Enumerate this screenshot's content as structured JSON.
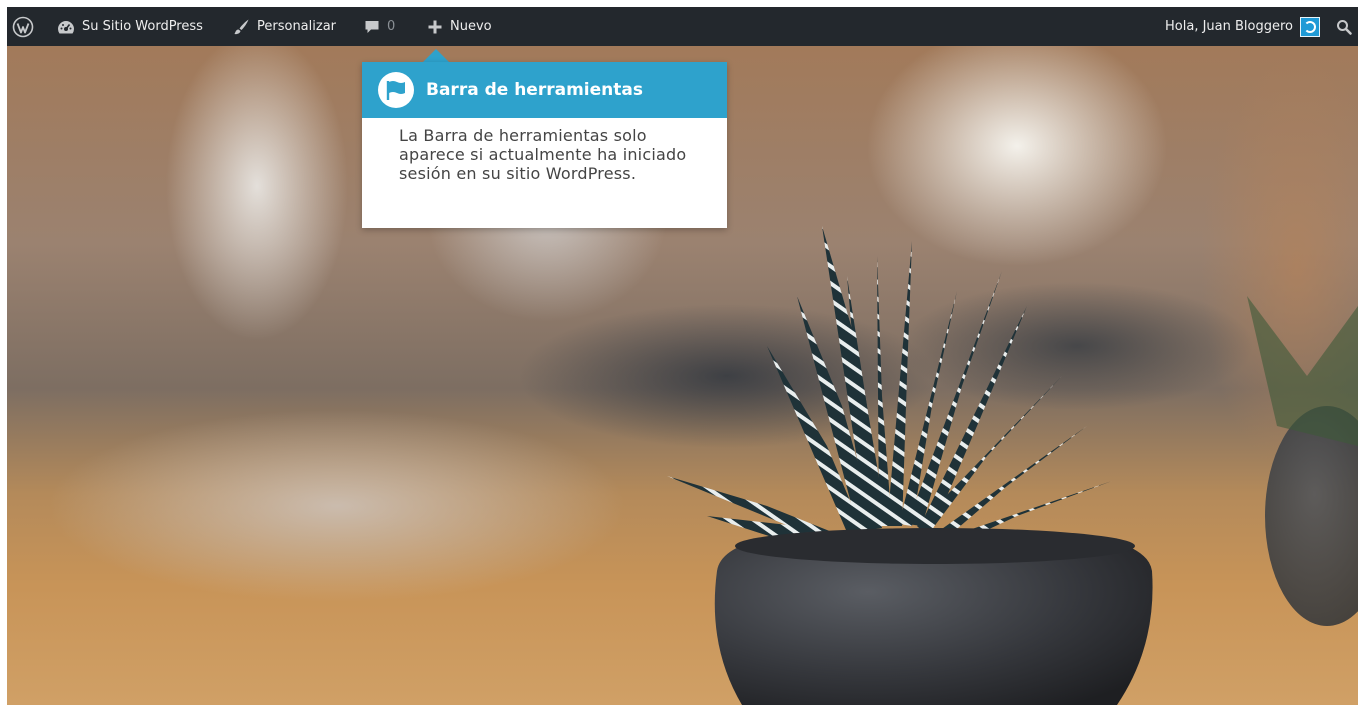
{
  "adminbar": {
    "wp_logo_icon": "wordpress-logo-icon",
    "site_icon": "dashboard-gauge-icon",
    "site_label": "Su Sitio WordPress",
    "customize_icon": "paintbrush-icon",
    "customize_label": "Personalizar",
    "comments_icon": "comment-bubble-icon",
    "comments_count": "0",
    "new_icon": "plus-icon",
    "new_label": "Nuevo",
    "account_label": "Hola, Juan Bloggero",
    "search_icon": "search-icon",
    "background_color": "#23282d",
    "text_color": "#eeeeee"
  },
  "tooltip": {
    "title": "Barra de herramientas",
    "body": "La Barra de herramientas solo aparece si actualmente ha iniciado sesión en su sitio WordPress.",
    "header_color": "#2ea2cc",
    "icon": "flag-icon"
  },
  "hero": {
    "image_subject_icon": "potted-succulent-photo"
  }
}
